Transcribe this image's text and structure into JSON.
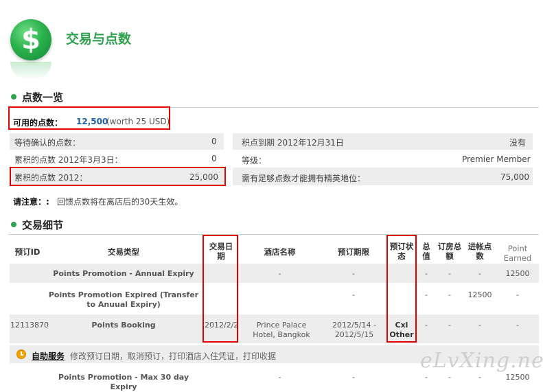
{
  "header": {
    "title": "交易与点数",
    "logo_symbol": "$"
  },
  "points_summary": {
    "section_title": "点数一览",
    "available_label": "可用的点数：",
    "available_value": "12,500",
    "available_worth": "(worth 25 USD)",
    "left_rows": [
      {
        "label": "等待确认的点数：",
        "value": "0"
      },
      {
        "label": "累积的点数   2012年3月3日：",
        "value": "0"
      },
      {
        "label": "累积的点数   2012：",
        "value": "25,000"
      }
    ],
    "right_rows": [
      {
        "label": "积点到期 2012年12月31日",
        "value": "没有"
      },
      {
        "label": "等级：",
        "value": "Premier Member"
      },
      {
        "label": "需有足够点数才能拥有精英地位：",
        "value": "75,000"
      }
    ],
    "note_label": "请注意：:",
    "note_text": "回馈点数将在离店后的30天生效。"
  },
  "transactions": {
    "section_title": "交易细节",
    "columns": [
      "预订ID",
      "交易类型",
      "交易日期",
      "酒店名称",
      "预订期限",
      "预订状态",
      "总值",
      "订房总额",
      "进帐点数",
      "Point Earned"
    ],
    "rows": [
      {
        "id": "",
        "type": "Points Promotion - Annual Expiry",
        "date": "",
        "hotel": "-",
        "period": "-",
        "status": "",
        "total": "-",
        "booking_total": "-",
        "points_in": "-",
        "points_earned": "12500"
      },
      {
        "id": "",
        "type": "Points Promotion Expired (Transfer to Anuual Expiry)",
        "date": "",
        "hotel": "",
        "period": "-",
        "status": "",
        "total": "-",
        "booking_total": "-",
        "points_in": "12500",
        "points_earned": "-"
      },
      {
        "id": "12113870",
        "type": "Points Booking",
        "date": "2012/2/2",
        "hotel": "Prince Palace Hotel, Bangkok",
        "period": "2012/5/14 - 2012/5/15",
        "status": "Cxl Other",
        "total": "-",
        "booking_total": "-",
        "points_in": "-",
        "points_earned": "-"
      },
      {
        "id": "",
        "type": "Points Promotion - Max 30 day Expiry",
        "date": "",
        "hotel": "-",
        "period": "-",
        "status": "",
        "total": "-",
        "booking_total": "-",
        "points_in": "-",
        "points_earned": "12500"
      }
    ],
    "self_service": {
      "link_label": "自助服务",
      "description": "修改预订日期，取消预订，打印酒店入住凭证，打印收据"
    }
  },
  "watermark": "eLvXing.net",
  "colors": {
    "accent_green": "#2fa14e",
    "highlight_red": "#e00000",
    "link_blue": "#1d5fa6"
  }
}
